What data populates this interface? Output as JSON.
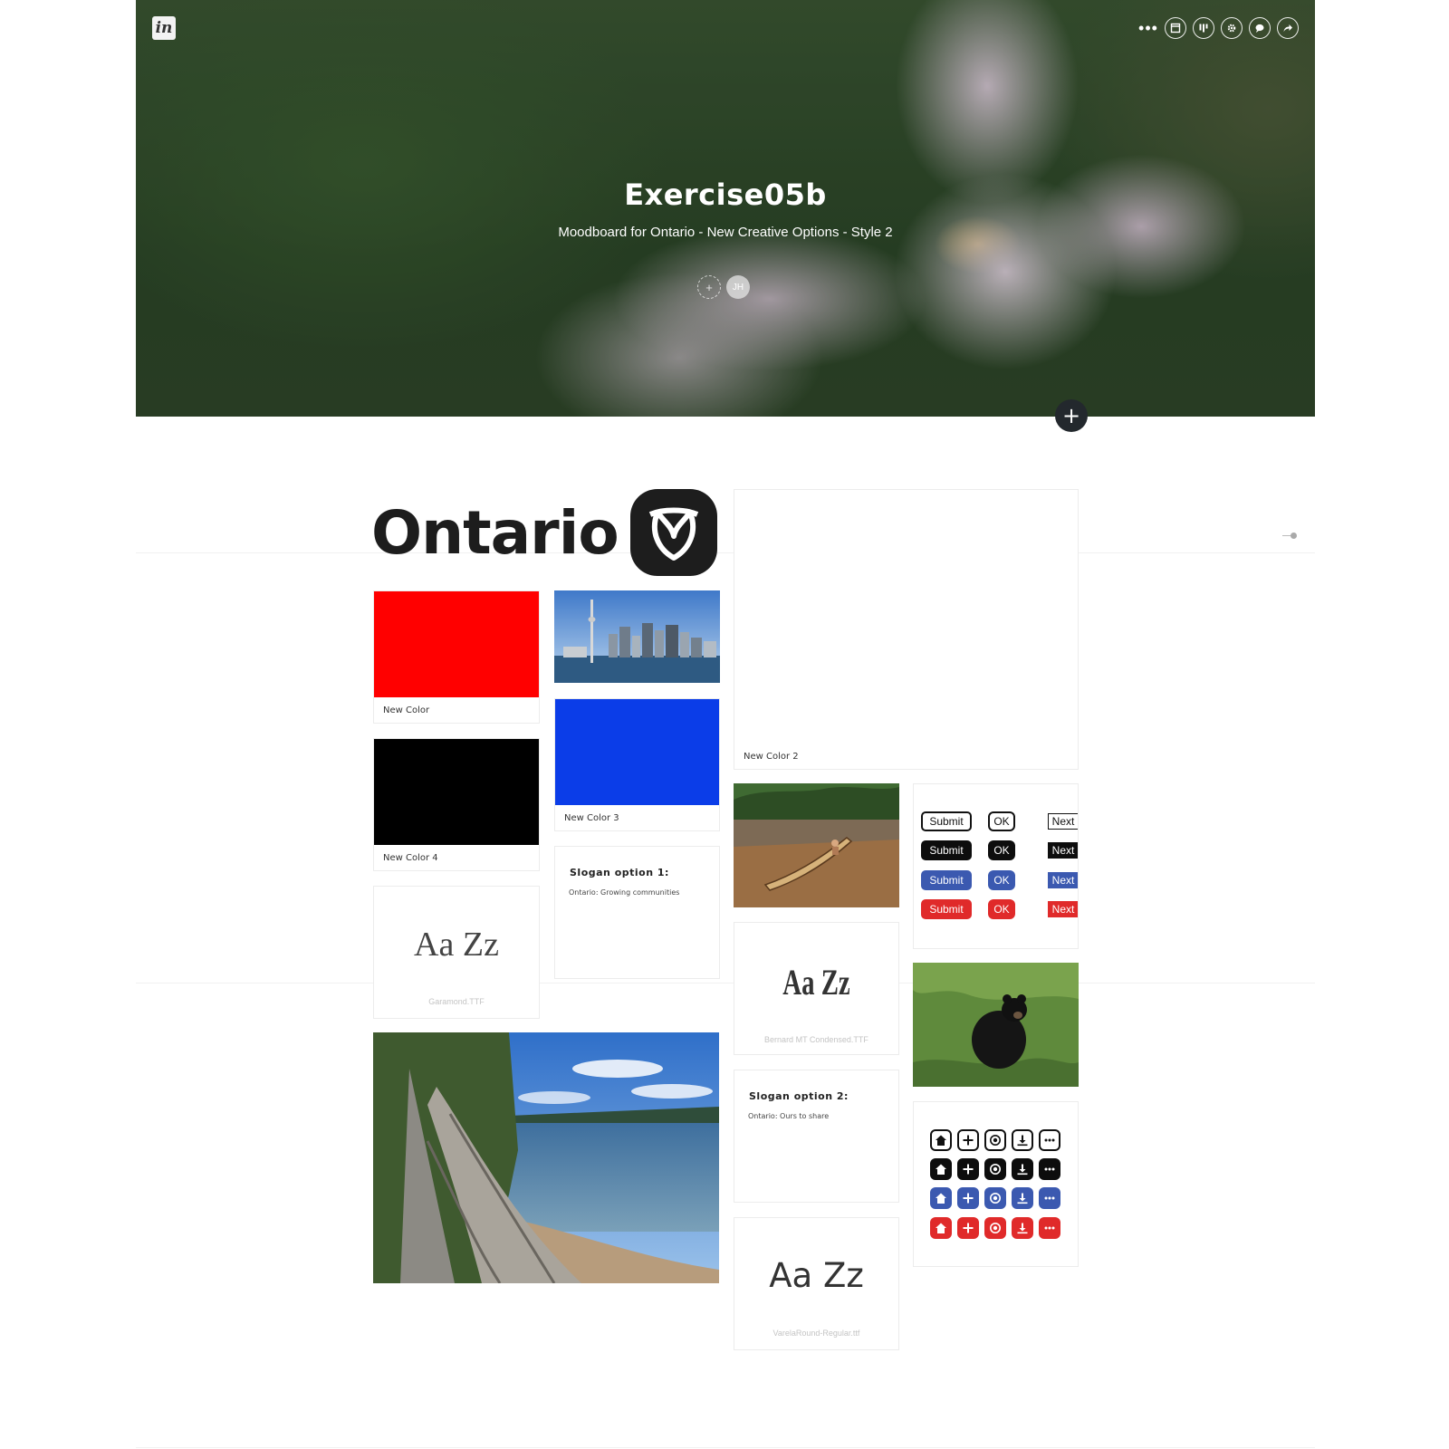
{
  "hero": {
    "title": "Exercise05b",
    "subtitle": "Moodboard for Ontario - New Creative Options - Style 2",
    "logo_text": "in",
    "add_avatar_label": "+",
    "user_initials": "JH",
    "toolbar": {
      "more": "•••",
      "icons": [
        "layout-icon",
        "board-icon",
        "gear-icon",
        "comment-icon",
        "share-icon"
      ]
    },
    "add_section_label": "+"
  },
  "board": {
    "logo_wordmark": "Ontario",
    "colors": [
      {
        "label": "New Color",
        "hex": "#ff0000"
      },
      {
        "label": "New Color 2",
        "hex": "#ffffff"
      },
      {
        "label": "New Color 3",
        "hex": "#0b3de8"
      },
      {
        "label": "New Color 4",
        "hex": "#000000"
      }
    ],
    "fonts": [
      {
        "sample": "Aa Zz",
        "name": "Garamond.TTF"
      },
      {
        "sample": "Aa Zz",
        "name": "Bernard MT Condensed.TTF"
      },
      {
        "sample": "Aa Zz",
        "name": "VarelaRound-Regular.ttf"
      }
    ],
    "slogans": [
      {
        "title": "Slogan option 1:",
        "text": "Ontario: Growing communities"
      },
      {
        "title": "Slogan option 2:",
        "text": "Ontario: Ours to share"
      }
    ],
    "buttons": {
      "submit": "Submit",
      "ok": "OK",
      "next": "Next",
      "styles": [
        "outline",
        "black",
        "blue",
        "red"
      ],
      "colors": {
        "blue": "#3b59b0",
        "red": "#e02a2a",
        "black": "#0d0d0d"
      }
    },
    "icon_set": {
      "icons": [
        "home-icon",
        "plus-icon",
        "trillium-icon",
        "download-icon",
        "more-icon"
      ],
      "styles": [
        "outline",
        "black",
        "blue",
        "red"
      ]
    },
    "photos": [
      "toronto-skyline-photo",
      "canoe-lake-photo",
      "black-bear-photo",
      "driftwood-shore-photo"
    ]
  }
}
